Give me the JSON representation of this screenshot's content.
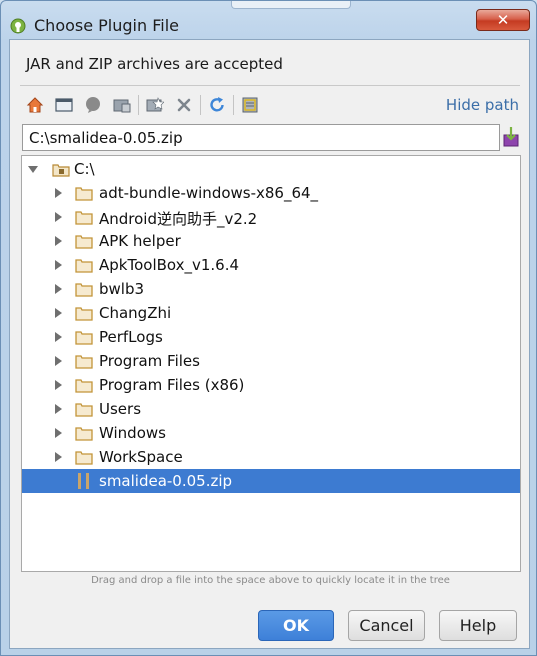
{
  "window": {
    "title": "Choose Plugin File",
    "close_glyph": "✕"
  },
  "header": {
    "message": "JAR and ZIP archives are accepted"
  },
  "toolbar": {
    "icons": [
      "home-icon",
      "desktop-icon",
      "project-icon",
      "module-icon",
      "new-folder-icon",
      "delete-icon",
      "refresh-icon",
      "show-hidden-icon"
    ],
    "hide_path_label": "Hide path"
  },
  "path": {
    "value": "C:\\smalidea-0.05.zip"
  },
  "tree": {
    "root": {
      "label": "C:\\"
    },
    "items": [
      {
        "label": "adt-bundle-windows-x86_64_",
        "type": "folder"
      },
      {
        "label": "Android逆向助手_v2.2",
        "type": "folder"
      },
      {
        "label": "APK helper",
        "type": "folder"
      },
      {
        "label": "ApkToolBox_v1.6.4",
        "type": "folder"
      },
      {
        "label": "bwlb3",
        "type": "folder"
      },
      {
        "label": "ChangZhi",
        "type": "folder"
      },
      {
        "label": "PerfLogs",
        "type": "folder"
      },
      {
        "label": "Program Files",
        "type": "folder"
      },
      {
        "label": "Program Files (x86)",
        "type": "folder"
      },
      {
        "label": "Users",
        "type": "folder"
      },
      {
        "label": "Windows",
        "type": "folder"
      },
      {
        "label": "WorkSpace",
        "type": "folder"
      },
      {
        "label": "smalidea-0.05.zip",
        "type": "archive",
        "selected": true
      }
    ]
  },
  "hint": "Drag and drop a file into the space above to quickly locate it in the tree",
  "buttons": {
    "ok": "OK",
    "cancel": "Cancel",
    "help": "Help"
  },
  "colors": {
    "selection": "#3d7bd1",
    "link": "#3b6ea8",
    "folder": "#d9b15a",
    "ok_button": "#3e80d8"
  }
}
